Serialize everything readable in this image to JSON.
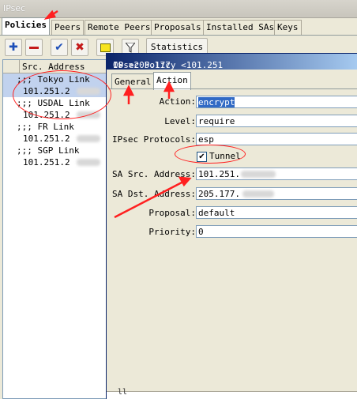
{
  "window": {
    "title": "IPsec"
  },
  "tabs": [
    "Policies",
    "Peers",
    "Remote Peers",
    "Proposals",
    "Installed SAs",
    "Keys"
  ],
  "toolbar": {
    "statistics_label": "Statistics"
  },
  "list": {
    "header": "Src. Address",
    "rows": [
      {
        "text": ";;; Tokyo Link",
        "type": "comment",
        "selected": true
      },
      {
        "text": "101.251.2",
        "type": "entry",
        "selected": true
      },
      {
        "text": ";;; USDAL Link",
        "type": "comment",
        "selected": false
      },
      {
        "text": "101.251.2",
        "type": "entry",
        "selected": false
      },
      {
        "text": ";;; FR Link",
        "type": "comment",
        "selected": false
      },
      {
        "text": "101.251.2",
        "type": "entry",
        "selected": false
      },
      {
        "text": ";;; SGP Link",
        "type": "comment",
        "selected": false
      },
      {
        "text": "101.251.2",
        "type": "entry",
        "selected": false
      }
    ]
  },
  "dialog": {
    "title": "IPsec Policy <101.251",
    "title_mid": ":0->205.177.",
    "title_end": "0>",
    "tabs": [
      "General",
      "Action"
    ],
    "fields": {
      "action_label": "Action:",
      "action_value": "encrypt",
      "level_label": "Level:",
      "level_value": "require",
      "protocols_label": "IPsec Protocols:",
      "protocols_value": "esp",
      "tunnel_label": "Tunnel",
      "tunnel_checked": true,
      "sa_src_label": "SA Src. Address:",
      "sa_src_value": "101.251.",
      "sa_dst_label": "SA Dst. Address:",
      "sa_dst_value": "205.177.",
      "proposal_label": "Proposal:",
      "proposal_value": "default",
      "priority_label": "Priority:",
      "priority_value": "0"
    },
    "bottom_text": "ll"
  },
  "colors": {
    "annotation": "#ff2020",
    "selection": "#c1d2ee",
    "title_gradient_start": "#0a246a"
  },
  "icons": [
    "add-icon",
    "remove-icon",
    "enable-check-icon",
    "disable-x-icon",
    "comment-note-icon",
    "filter-funnel-icon"
  ]
}
